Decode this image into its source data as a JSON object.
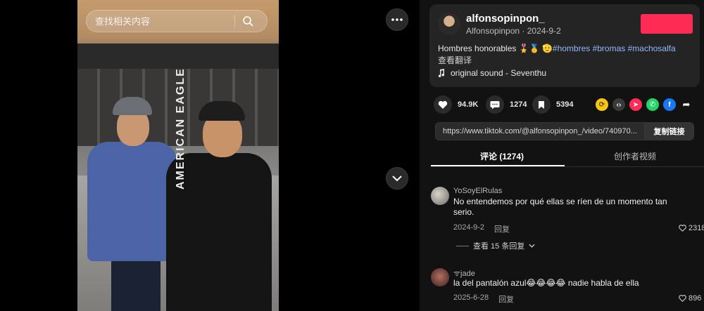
{
  "search": {
    "placeholder": "查找相关内容"
  },
  "video": {
    "sleeve_text": "AMERICAN EAGLE"
  },
  "author": {
    "username": "alfonsopinpon_",
    "subtitle": "Alfonsopinpon · 2024-9-2"
  },
  "post": {
    "caption_text": "Hombres honorables 🎖️🥇 🫡",
    "caption_tags": "#hombres #bromas #machosalfa",
    "translate": "查看翻译",
    "sound": "original sound - Seventhu"
  },
  "actions": {
    "likes": "94.9K",
    "comments": "1274",
    "saves": "5394"
  },
  "share_icons": [
    "repost-icon",
    "embed-icon",
    "send-icon",
    "whatsapp-icon",
    "facebook-icon",
    "share-arrow-icon"
  ],
  "link": {
    "url": "https://www.tiktok.com/@alfonsopinpon_/video/740970...",
    "copy_label": "复制链接"
  },
  "tabs": {
    "comments": "评论 (1274)",
    "creator": "创作者视频"
  },
  "comments": [
    {
      "user": "YoSoyElRulas",
      "text": "No entendemos por qué ellas se ríen de un momento tan serio.",
      "date": "2024-9-2",
      "reply": "回复",
      "likes": "2318",
      "view_replies": "查看 15 条回复"
    },
    {
      "user": "jade",
      "text": "la del pantalón azul😂😂😂😂 nadie habla de ella",
      "date": "2025-6-28",
      "reply": "回复",
      "likes": "896"
    }
  ],
  "colors": {
    "accent": "#fe2c55",
    "panel": "#242424",
    "tag": "#8fb8ff"
  }
}
